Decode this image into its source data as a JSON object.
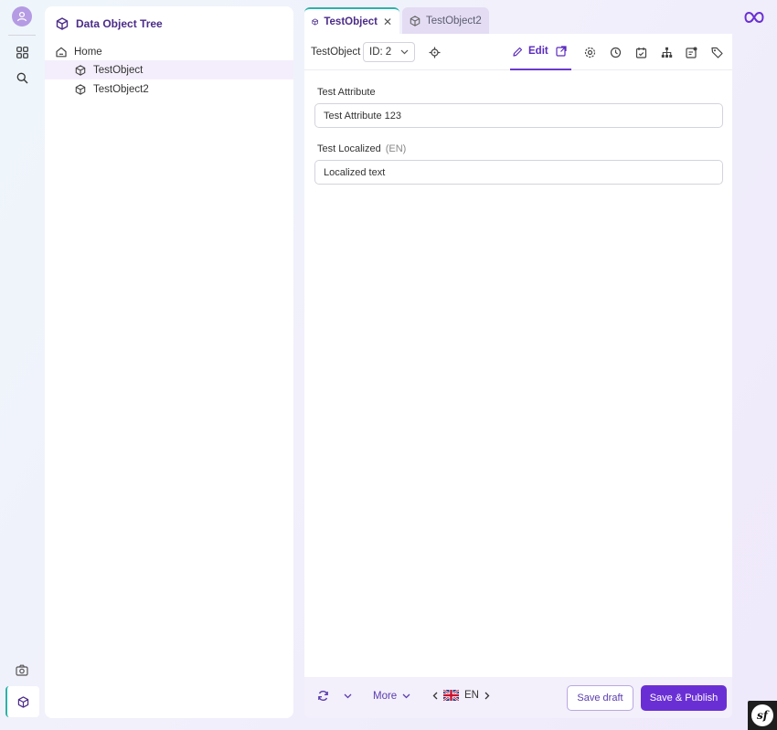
{
  "tree": {
    "title": "Data Object Tree",
    "items": [
      {
        "label": "Home"
      },
      {
        "label": "TestObject"
      },
      {
        "label": "TestObject2"
      }
    ]
  },
  "tabs": [
    {
      "label": "TestObject"
    },
    {
      "label": "TestObject2"
    }
  ],
  "toolbar": {
    "object_name": "TestObject",
    "id_label": "ID:",
    "id_value": "2",
    "edit_label": "Edit"
  },
  "fields": [
    {
      "label": "Test Attribute",
      "value": "Test Attribute 123"
    },
    {
      "label": "Test Localized",
      "qualifier": "(EN)",
      "value": "Localized text"
    }
  ],
  "footer": {
    "more_label": "More",
    "language": "EN",
    "save_draft_label": "Save draft",
    "save_publish_label": "Save & Publish"
  },
  "colors": {
    "accent": "#6a2fd4",
    "tab_indicator": "#2bb3a8",
    "selected_row": "#f4eefc"
  }
}
